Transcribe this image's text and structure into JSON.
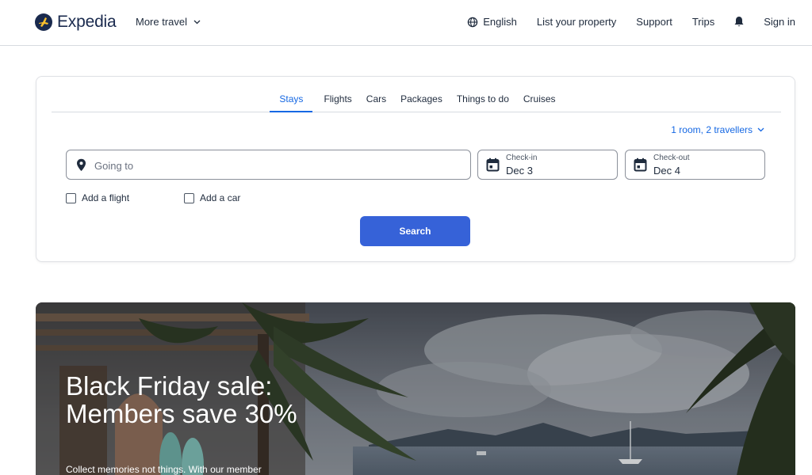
{
  "header": {
    "brand": "Expedia",
    "more_travel": "More travel",
    "language": "English",
    "list_property": "List your property",
    "support": "Support",
    "trips": "Trips",
    "sign_in": "Sign in"
  },
  "search": {
    "tabs": [
      "Stays",
      "Flights",
      "Cars",
      "Packages",
      "Things to do",
      "Cruises"
    ],
    "active_tab": "Stays",
    "travellers": "1 room, 2 travellers",
    "going_to_placeholder": "Going to",
    "checkin_label": "Check-in",
    "checkin_value": "Dec 3",
    "checkout_label": "Check-out",
    "checkout_value": "Dec 4",
    "add_flight": "Add a flight",
    "add_car": "Add a car",
    "search_button": "Search"
  },
  "hero": {
    "title": "Black Friday sale: Members save 30%",
    "subtitle": "Collect memories not things. With our member"
  },
  "colors": {
    "accent": "#1668e3",
    "button": "#3662d8",
    "brand": "#1a2a4e"
  },
  "icons": {
    "logo": "plane-logo-icon",
    "more_travel": "chevron-down-icon",
    "language": "globe-icon",
    "notifications": "bell-icon",
    "going_to": "location-pin-icon",
    "dates": "calendar-icon"
  }
}
